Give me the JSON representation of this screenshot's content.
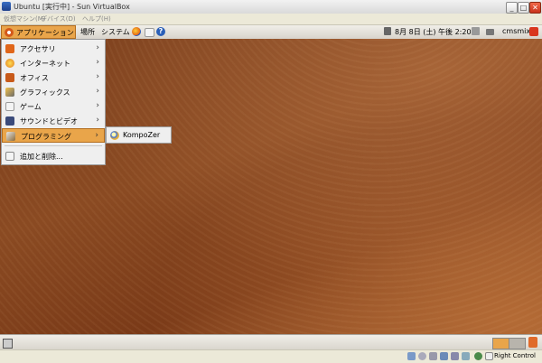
{
  "window": {
    "title": "Ubuntu [実行中] - Sun VirtualBox",
    "controls": {
      "minimize": "_",
      "maximize": "□",
      "close": "✕"
    }
  },
  "vbox_menu": {
    "items": [
      "仮想マシン(M)",
      "デバイス(D)",
      "ヘルプ(H)"
    ]
  },
  "panel": {
    "applications": "アプリケーション",
    "places": "場所",
    "system": "システム",
    "clock": "8月 8日 (土) 午後 2:20",
    "user": "cmsmix",
    "icons": [
      "firefox-icon",
      "mail-icon",
      "help-icon",
      "volume-icon",
      "network-icon",
      "printer-icon",
      "power-icon"
    ]
  },
  "app_menu": {
    "items": [
      {
        "label": "アクセサリ",
        "icon": "accessories-icon",
        "submenu": true
      },
      {
        "label": "インターネット",
        "icon": "internet-icon",
        "submenu": true
      },
      {
        "label": "オフィス",
        "icon": "office-icon",
        "submenu": true
      },
      {
        "label": "グラフィックス",
        "icon": "graphics-icon",
        "submenu": true
      },
      {
        "label": "ゲーム",
        "icon": "games-icon",
        "submenu": true
      },
      {
        "label": "サウンドとビデオ",
        "icon": "sound-video-icon",
        "submenu": true
      },
      {
        "label": "プログラミング",
        "icon": "programming-icon",
        "submenu": true,
        "selected": true
      }
    ],
    "extra": {
      "label": "追加と削除...",
      "icon": "add-remove-icon"
    },
    "arrow": "›"
  },
  "submenu": {
    "items": [
      {
        "label": "KompoZer",
        "icon": "kompozer-icon"
      }
    ]
  },
  "statusbar": {
    "host_key": "Right Control"
  },
  "colors": {
    "accent": "#e9a54a",
    "desktop": "#7a3e1c"
  }
}
